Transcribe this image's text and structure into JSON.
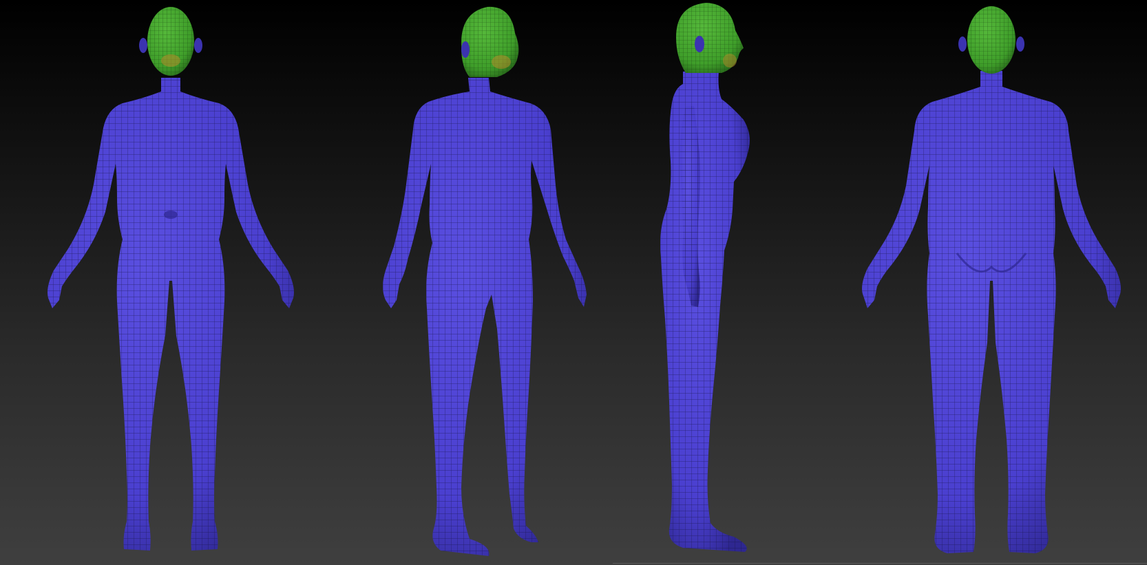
{
  "canvas": {
    "background_top": "#000000",
    "background_bottom": "#3f3f3f"
  },
  "colors": {
    "body_polygroup": "#4a3fcf",
    "body_shade": "#2e2790",
    "head_polygroup": "#3f9e2a",
    "head_shade": "#2a6e1c",
    "face_accent": "#b58a2a",
    "wire": "#15123f"
  },
  "views": [
    {
      "name": "front-view",
      "facing": "front"
    },
    {
      "name": "three-quarter-view",
      "facing": "three-quarter"
    },
    {
      "name": "side-view",
      "facing": "side"
    },
    {
      "name": "back-view",
      "facing": "back"
    }
  ]
}
